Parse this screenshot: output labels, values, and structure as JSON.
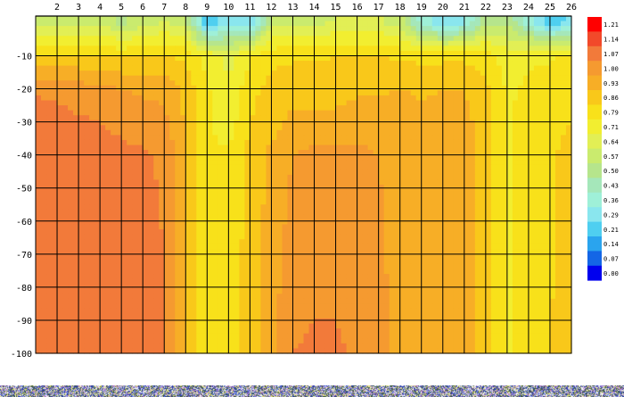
{
  "chart_data": {
    "type": "heatmap",
    "subtype": "filled-contour",
    "title": "",
    "xlabel": "",
    "ylabel": "",
    "x_ticks": [
      2,
      3,
      4,
      5,
      6,
      7,
      8,
      9,
      10,
      11,
      12,
      13,
      14,
      15,
      16,
      17,
      18,
      19,
      20,
      21,
      22,
      23,
      24,
      25,
      26
    ],
    "x_range": [
      1,
      26
    ],
    "y_ticks": [
      -10,
      -20,
      -30,
      -40,
      -50,
      -60,
      -70,
      -80,
      -90,
      -100
    ],
    "y_range": [
      -100,
      2
    ],
    "grid": true,
    "x_axis_position": "top",
    "legend_position": "right",
    "colorbar": {
      "labels": [
        "1.21",
        "1.14",
        "1.07",
        "1.00",
        "0.93",
        "0.86",
        "0.79",
        "0.71",
        "0.64",
        "0.57",
        "0.50",
        "0.43",
        "0.36",
        "0.29",
        "0.21",
        "0.14",
        "0.07",
        "0.00"
      ],
      "colors": [
        "#ff0000",
        "#f2492a",
        "#f27a3a",
        "#f59a30",
        "#f7ae26",
        "#f9c81a",
        "#f8e11a",
        "#f2ee30",
        "#e2ef55",
        "#caeb6e",
        "#b6e58c",
        "#a5e7ba",
        "#9ff0d8",
        "#8ae6ee",
        "#4fcff0",
        "#2aa4ee",
        "#1466e6",
        "#0000ee"
      ]
    },
    "column_profiles": {
      "x": [
        1,
        2,
        3,
        4,
        5,
        6,
        7,
        8,
        9,
        10,
        11,
        12,
        13,
        14,
        15,
        16,
        17,
        18,
        19,
        20,
        21,
        22,
        23,
        24,
        25,
        26
      ],
      "depth_breaks": [
        0,
        -10,
        -20,
        -30,
        -40,
        -100
      ],
      "values": [
        [
          0.62,
          0.86,
          1.06,
          1.1,
          1.1,
          1.1
        ],
        [
          0.62,
          0.86,
          1.05,
          1.1,
          1.1,
          1.1
        ],
        [
          0.63,
          0.87,
          1.03,
          1.08,
          1.1,
          1.1
        ],
        [
          0.63,
          0.86,
          1.02,
          1.07,
          1.1,
          1.1
        ],
        [
          0.55,
          0.85,
          1.0,
          1.05,
          1.09,
          1.1
        ],
        [
          0.62,
          0.86,
          0.99,
          1.03,
          1.08,
          1.1
        ],
        [
          0.64,
          0.87,
          0.98,
          1.02,
          1.06,
          1.08
        ],
        [
          0.6,
          0.84,
          0.91,
          0.92,
          0.93,
          0.95
        ],
        [
          0.22,
          0.76,
          0.8,
          0.8,
          0.8,
          0.79
        ],
        [
          0.35,
          0.68,
          0.72,
          0.75,
          0.8,
          0.83
        ],
        [
          0.3,
          0.78,
          0.84,
          0.86,
          0.88,
          0.9
        ],
        [
          0.6,
          0.84,
          0.88,
          0.9,
          0.95,
          0.98
        ],
        [
          0.62,
          0.85,
          0.9,
          0.95,
          1.0,
          1.07
        ],
        [
          0.63,
          0.85,
          0.9,
          0.95,
          1.02,
          1.08
        ],
        [
          0.64,
          0.86,
          0.9,
          0.95,
          1.02,
          1.08
        ],
        [
          0.64,
          0.86,
          0.92,
          0.96,
          1.02,
          1.06
        ],
        [
          0.65,
          0.86,
          0.92,
          0.96,
          1.0,
          1.02
        ],
        [
          0.6,
          0.85,
          0.93,
          0.97,
          0.98,
          0.98
        ],
        [
          0.4,
          0.84,
          0.92,
          0.95,
          0.96,
          0.96
        ],
        [
          0.3,
          0.84,
          0.93,
          0.95,
          0.96,
          0.96
        ],
        [
          0.35,
          0.84,
          0.93,
          0.95,
          0.96,
          0.96
        ],
        [
          0.55,
          0.82,
          0.88,
          0.9,
          0.9,
          0.88
        ],
        [
          0.55,
          0.75,
          0.78,
          0.78,
          0.78,
          0.78
        ],
        [
          0.4,
          0.78,
          0.8,
          0.82,
          0.82,
          0.82
        ],
        [
          0.25,
          0.78,
          0.82,
          0.84,
          0.85,
          0.86
        ],
        [
          0.3,
          0.8,
          0.84,
          0.86,
          0.88,
          0.88
        ]
      ]
    }
  }
}
